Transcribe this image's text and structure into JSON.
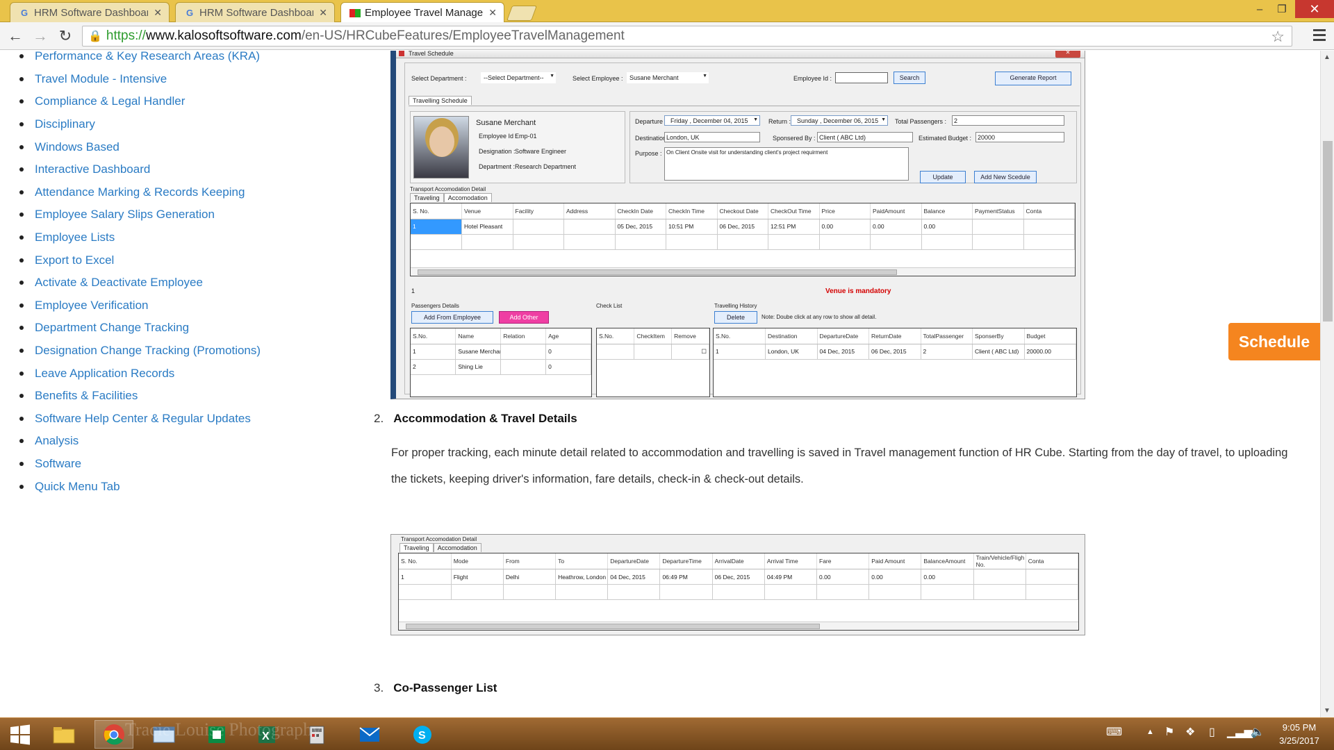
{
  "browser": {
    "tabs": [
      {
        "label": "HRM Software Dashboard",
        "active": false
      },
      {
        "label": "HRM Software Dashboard",
        "active": false
      },
      {
        "label": "Employee Travel Manager",
        "active": true
      }
    ],
    "url_protocol": "https://",
    "url_host": "www.kalosoftsoftware.com",
    "url_path": "/en-US/HRCubeFeatures/EmployeeTravelManagement",
    "window_buttons": {
      "minimize": "–",
      "restore": "❐",
      "close": "✕"
    }
  },
  "sidebar": {
    "items": [
      "Performance & Key Research Areas (KRA)",
      "Travel Module - Intensive",
      "Compliance & Legal Handler",
      "Disciplinary",
      "Windows Based",
      "Interactive Dashboard",
      "Attendance Marking & Records Keeping",
      "Employee Salary Slips Generation",
      "Employee Lists",
      "Export to Excel",
      "Activate & Deactivate Employee",
      "Employee Verification",
      "Department Change Tracking",
      "Designation Change Tracking (Promotions)",
      "Leave Application Records",
      "Benefits & Facilities",
      "Software Help Center & Regular Updates",
      "Analysis",
      "Software",
      "Quick Menu Tab"
    ]
  },
  "travel_schedule": {
    "window_title": "Travel Schedule",
    "select_department_label": "Select Department :",
    "select_department_value": "--Select Department--",
    "select_employee_label": "Select Employee :",
    "select_employee_value": "Susane  Merchant",
    "employee_id_label": "Employee Id :",
    "search_button": "Search",
    "generate_report_button": "Generate Report",
    "tab_label": "Travelling Schedule",
    "employee": {
      "name": "Susane  Merchant",
      "id_label": "Employee Id :",
      "id_value": "Emp-01",
      "designation_label": "Designation :",
      "designation_value": "Software Engineer",
      "department_label": "Department :",
      "department_value": "Research Department"
    },
    "departure_label": "Departure :",
    "departure_value": "Friday    , December 04, 2015",
    "return_label": "Return :",
    "return_value": "Sunday   , December 06, 2015",
    "total_passengers_label": "Total Passengers :",
    "total_passengers_value": "2",
    "destination_label": "Destination :",
    "destination_value": "London, UK",
    "sponsored_by_label": "Sponsered By :",
    "sponsored_by_value": "Client ( ABC Ltd)",
    "estimated_budget_label": "Estimated Budget :",
    "estimated_budget_value": "20000",
    "purpose_label": "Purpose :",
    "purpose_value": "On Client Onsite visit for understanding client's project requirment",
    "update_button": "Update",
    "add_new_button": "Add New Scedule",
    "transport_group": "Transport Accomodation Detail",
    "subtabs": [
      "Traveling",
      "Accomodation"
    ],
    "accommodation_columns": [
      "S. No.",
      "Venue",
      "Facility",
      "Address",
      "CheckIn Date",
      "CheckIn Time",
      "Checkout Date",
      "CheckOut Time",
      "Price",
      "PaidAmount",
      "Balance",
      "PaymentStatus",
      "Conta"
    ],
    "accommodation_rows": [
      [
        "1",
        "Hotel Pleasant",
        "",
        "",
        "05 Dec, 2015",
        "10:51 PM",
        "06 Dec, 2015",
        "12:51 PM",
        "0.00",
        "0.00",
        "0.00",
        "",
        ""
      ]
    ],
    "row_counter": "1",
    "validation_message": "Venue is mandatory",
    "passengers_title": "Passengers Details",
    "add_from_employee_button": "Add From Employee",
    "add_other_button": "Add Other",
    "passenger_columns": [
      "S.No.",
      "Name",
      "Relation",
      "Age"
    ],
    "passenger_rows": [
      [
        "1",
        "Susane  Merchant",
        "",
        "0"
      ],
      [
        "2",
        "Shing  Lie",
        "",
        "0"
      ]
    ],
    "checklist_title": "Check List",
    "checklist_columns": [
      "S.No.",
      "CheckItem",
      "Remove"
    ],
    "history_title": "Travelling History",
    "delete_button": "Delete",
    "history_note": "Note: Doube click at any row to show all detail.",
    "history_columns": [
      "S.No.",
      "Destination",
      "DepartureDate",
      "ReturnDate",
      "TotalPassenger",
      "SponserBy",
      "Budget"
    ],
    "history_rows": [
      [
        "1",
        "London, UK",
        "04 Dec, 2015",
        "06 Dec, 2015",
        "2",
        "Client ( ABC Ltd)",
        "20000.00"
      ]
    ]
  },
  "section2": {
    "number": "2.",
    "title": "Accommodation & Travel Details",
    "paragraph": "For proper tracking, each minute detail related to accommodation and travelling is saved in Travel management function of HR Cube. Starting from the day of travel, to uploading the tickets, keeping driver's information, fare details, check-in & check-out details."
  },
  "travel_detail": {
    "group": "Transport Accomodation Detail",
    "subtabs": [
      "Traveling",
      "Accomodation"
    ],
    "columns": [
      "S. No.",
      "Mode",
      "From",
      "To",
      "DepartureDate",
      "DepartureTime",
      "ArrivalDate",
      "Arrival Time",
      "Fare",
      "Paid Amount",
      "BalanceAmount",
      "Train/Vehicle/Fligh No.",
      "Conta"
    ],
    "rows": [
      [
        "1",
        "Flight",
        "Delhi",
        "Heathrow, London",
        "04 Dec, 2015",
        "06:49 PM",
        "06 Dec, 2015",
        "04:49 PM",
        "0.00",
        "0.00",
        "0.00",
        "",
        ""
      ]
    ]
  },
  "section3": {
    "number": "3.",
    "title": "Co-Passenger List"
  },
  "schedule_button": "Schedule",
  "taskbar": {
    "clock_time": "9:05 PM",
    "clock_date": "3/25/2017",
    "watermark": "Tracie Louise Photography",
    "apps": [
      "file-explorer-icon",
      "chrome-icon",
      "window-icon",
      "publisher-icon",
      "excel-icon",
      "calculator-icon",
      "mail-icon",
      "skype-icon"
    ]
  },
  "colors": {
    "tabstrip": "#e9c34a",
    "link": "#2a7bc4",
    "schedule_button": "#f5851f",
    "validation": "#d40000",
    "taskbar": "#8a5a28"
  }
}
